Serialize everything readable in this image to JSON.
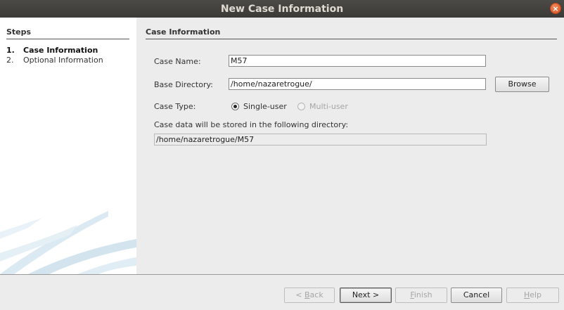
{
  "window": {
    "title": "New Case Information",
    "close_glyph": "×"
  },
  "steps": {
    "heading": "Steps",
    "items": [
      {
        "num": "1.",
        "label": "Case Information",
        "active": true
      },
      {
        "num": "2.",
        "label": "Optional Information",
        "active": false
      }
    ]
  },
  "form": {
    "section_title": "Case Information",
    "case_name_label": "Case Name:",
    "case_name_value": "M57",
    "base_dir_label": "Base Directory:",
    "base_dir_value": "/home/nazaretrogue/",
    "browse_label": "Browse",
    "case_type_label": "Case Type:",
    "case_type_options": [
      {
        "label": "Single-user",
        "selected": true,
        "enabled": true
      },
      {
        "label": "Multi-user",
        "selected": false,
        "enabled": false
      }
    ],
    "storage_note": "Case data will be stored in the following directory:",
    "storage_path": "/home/nazaretrogue/M57"
  },
  "buttons": {
    "back_prefix": "< ",
    "back_mnemonic": "B",
    "back_rest": "ack",
    "next": "Next >",
    "finish_mnemonic": "F",
    "finish_rest": "inish",
    "cancel": "Cancel",
    "help_mnemonic": "H",
    "help_rest": "elp"
  },
  "colors": {
    "title_bar": "#3d3c38",
    "close_button": "#e2622b",
    "panel_bg": "#ececec",
    "steps_bg": "#ffffff",
    "watermark": "#dbe9f2"
  }
}
